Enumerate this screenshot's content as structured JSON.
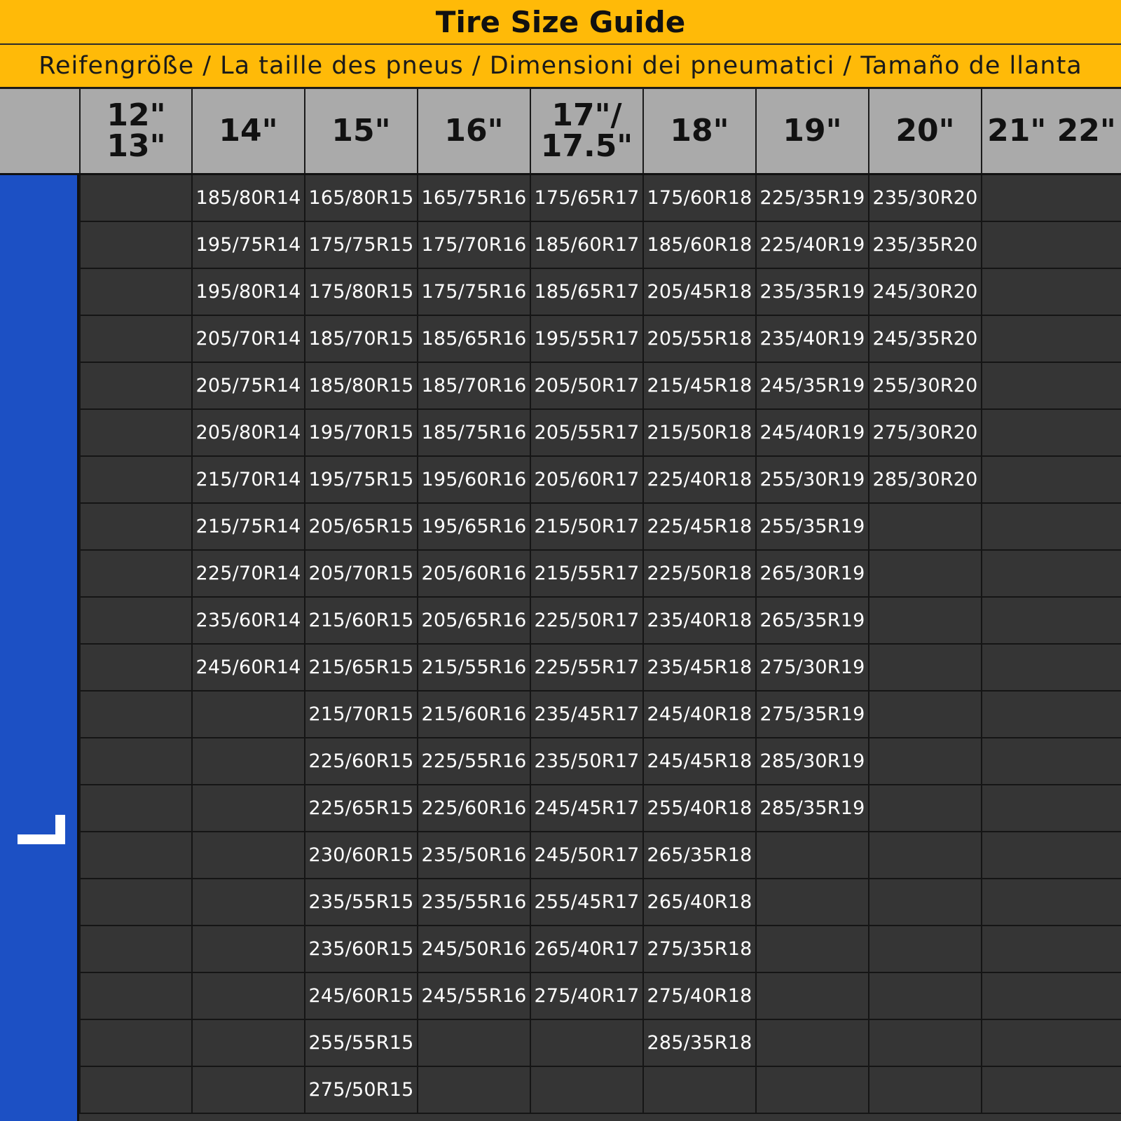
{
  "title": "Tire Size Guide",
  "subtitle": "Reifengröße / La taille des pneus / Dimensioni dei pneumatici / Tamaño de llanta",
  "colors": {
    "banner": "#FFBA08",
    "header": "#AAAAAA",
    "side_strip": "#1C50C4",
    "body": "#353535",
    "cell_text": "#FFFFFF"
  },
  "side_icon": "corner-bracket-icon",
  "columns": [
    {
      "label": "12\" 13\"",
      "sizes": []
    },
    {
      "label": "14\"",
      "sizes": [
        "185/80R14",
        "195/75R14",
        "195/80R14",
        "205/70R14",
        "205/75R14",
        "205/80R14",
        "215/70R14",
        "215/75R14",
        "225/70R14",
        "235/60R14",
        "245/60R14"
      ]
    },
    {
      "label": "15\"",
      "sizes": [
        "165/80R15",
        "175/75R15",
        "175/80R15",
        "185/70R15",
        "185/80R15",
        "195/70R15",
        "195/75R15",
        "205/65R15",
        "205/70R15",
        "215/60R15",
        "215/65R15",
        "215/70R15",
        "225/60R15",
        "225/65R15",
        "230/60R15",
        "235/55R15",
        "235/60R15",
        "245/60R15",
        "255/55R15",
        "275/50R15"
      ]
    },
    {
      "label": "16\"",
      "sizes": [
        "165/75R16",
        "175/70R16",
        "175/75R16",
        "185/65R16",
        "185/70R16",
        "185/75R16",
        "195/60R16",
        "195/65R16",
        "205/60R16",
        "205/65R16",
        "215/55R16",
        "215/60R16",
        "225/55R16",
        "225/60R16",
        "235/50R16",
        "235/55R16",
        "245/50R16",
        "245/55R16"
      ]
    },
    {
      "label": "17\"/\n17.5\"",
      "sizes": [
        "175/65R17",
        "185/60R17",
        "185/65R17",
        "195/55R17",
        "205/50R17",
        "205/55R17",
        "205/60R17",
        "215/50R17",
        "215/55R17",
        "225/50R17",
        "225/55R17",
        "235/45R17",
        "235/50R17",
        "245/45R17",
        "245/50R17",
        "255/45R17",
        "265/40R17",
        "275/40R17"
      ]
    },
    {
      "label": "18\"",
      "sizes": [
        "175/60R18",
        "185/60R18",
        "205/45R18",
        "205/55R18",
        "215/45R18",
        "215/50R18",
        "225/40R18",
        "225/45R18",
        "225/50R18",
        "235/40R18",
        "235/45R18",
        "245/40R18",
        "245/45R18",
        "255/40R18",
        "265/35R18",
        "265/40R18",
        "275/35R18",
        "275/40R18",
        "285/35R18"
      ]
    },
    {
      "label": "19\"",
      "sizes": [
        "225/35R19",
        "225/40R19",
        "235/35R19",
        "235/40R19",
        "245/35R19",
        "245/40R19",
        "255/30R19",
        "255/35R19",
        "265/30R19",
        "265/35R19",
        "275/30R19",
        "275/35R19",
        "285/30R19",
        "285/35R19"
      ]
    },
    {
      "label": "20\"",
      "sizes": [
        "235/30R20",
        "235/35R20",
        "245/30R20",
        "245/35R20",
        "255/30R20",
        "275/30R20",
        "285/30R20"
      ]
    },
    {
      "label": "21\" 22\"",
      "sizes": []
    }
  ]
}
